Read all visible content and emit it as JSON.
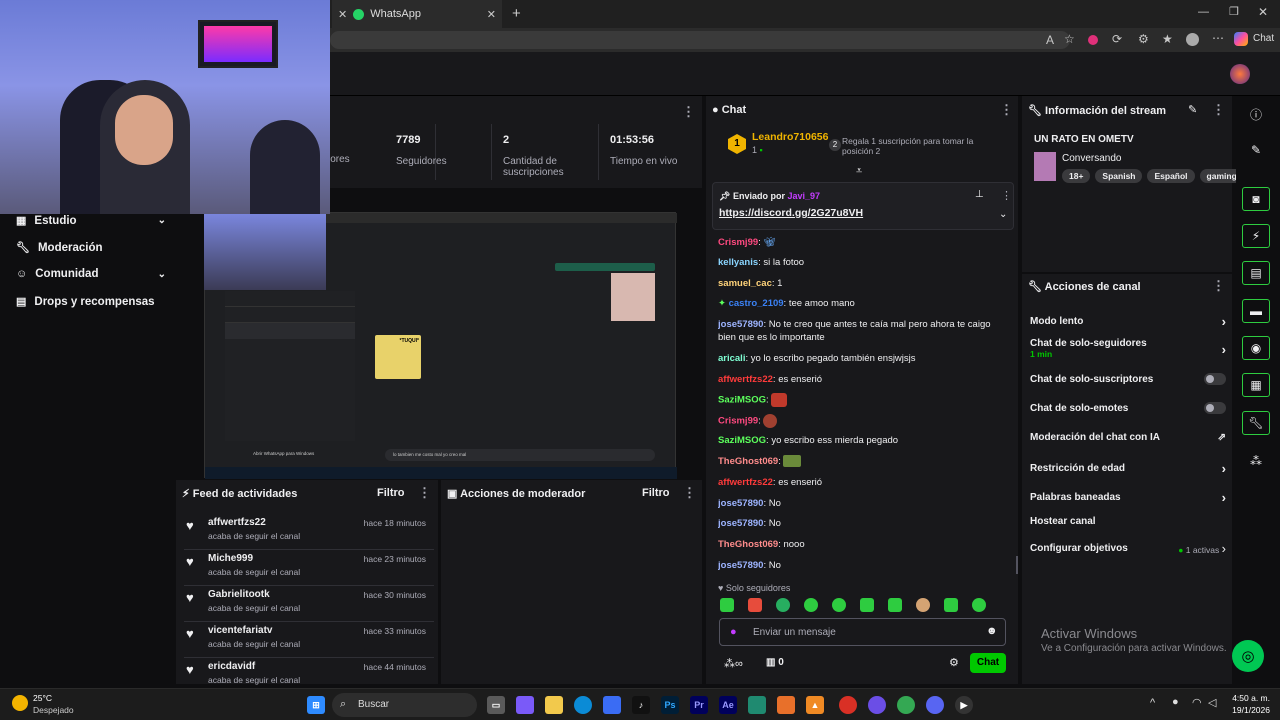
{
  "browser": {
    "tab_title": "WhatsApp",
    "chat_label": "Chat"
  },
  "stats": [
    {
      "value": "",
      "label": "lores"
    },
    {
      "value": "7789",
      "label": "Seguidores"
    },
    {
      "value": "2",
      "label": "Cantidad de suscripciones"
    },
    {
      "value": "01:53:56",
      "label": "Tiempo en vivo"
    }
  ],
  "sidebar": {
    "items": [
      {
        "label": "Estudio",
        "has_chevron": true
      },
      {
        "label": "Moderación",
        "has_chevron": false
      },
      {
        "label": "Comunidad",
        "has_chevron": true
      },
      {
        "label": "Drops y recompensas",
        "has_chevron": false
      }
    ]
  },
  "preview": {
    "banner_title": "Abrir WhatsApp para Windows",
    "tuqui_label": "*TUQUI*",
    "chat_input": "lo tambien me costo mal yo creo mal"
  },
  "activity_feed": {
    "title": "Feed de actividades",
    "filter": "Filtro",
    "items": [
      {
        "user": "affwertfzs22",
        "action": "acaba de seguir el canal",
        "time": "hace 18 minutos"
      },
      {
        "user": "Miche999",
        "action": "acaba de seguir el canal",
        "time": "hace 23 minutos"
      },
      {
        "user": "Gabrielitootk",
        "action": "acaba de seguir el canal",
        "time": "hace 30 minutos"
      },
      {
        "user": "vicentefariatv",
        "action": "acaba de seguir el canal",
        "time": "hace 33 minutos"
      },
      {
        "user": "ericdavidf",
        "action": "acaba de seguir el canal",
        "time": "hace 44 minutos"
      }
    ]
  },
  "mod_actions": {
    "title": "Acciones de moderador",
    "filter": "Filtro"
  },
  "chat": {
    "title": "Chat",
    "gift_user": "Leandro710656",
    "gift_count": "1",
    "gift_text": "Regala 1 suscripción para tomar la posición 2",
    "gift_rank": "2",
    "pinned_label": "Enviado por",
    "pinned_by": "Javi_97",
    "pinned_link": "https://discord.gg/2G27u8VH",
    "messages": [
      {
        "user": "Crismj99",
        "text": "",
        "color": "#ff4a80"
      },
      {
        "user": "kellyanis",
        "text": "si la fotoo",
        "color": "#8ad5ff"
      },
      {
        "user": "samuel_cac",
        "text": "1",
        "color": "#ffd37a"
      },
      {
        "user": "castro_2109",
        "text": "tee amoo mano",
        "color": "#3b82f6"
      },
      {
        "user": "jose57890",
        "text": "No te creo que antes te caía mal pero ahora te caigo bien que es lo importante",
        "color": "#9db4ff"
      },
      {
        "user": "aricali",
        "text": "yo lo escribo pegado también ensjwjsjs",
        "color": "#7fffd4"
      },
      {
        "user": "affwertfzs22",
        "text": "es enserió",
        "color": "#ff3b3b"
      },
      {
        "user": "SaziMSOG",
        "text": "",
        "color": "#5cff5c"
      },
      {
        "user": "Crismj99",
        "text": "",
        "color": "#ff4a80"
      },
      {
        "user": "SaziMSOG",
        "text": "yo escribo ess mierda pegado",
        "color": "#5cff5c"
      },
      {
        "user": "TheGhost069",
        "text": "",
        "color": "#ff8c8c"
      },
      {
        "user": "affwertfzs22",
        "text": "es enserió",
        "color": "#ff3b3b"
      },
      {
        "user": "jose57890",
        "text": "No",
        "color": "#9db4ff"
      },
      {
        "user": "jose57890",
        "text": "No",
        "color": "#9db4ff"
      },
      {
        "user": "TheGhost069",
        "text": "nooo",
        "color": "#ff8c8c"
      },
      {
        "user": "jose57890",
        "text": "No",
        "color": "#9db4ff"
      }
    ],
    "followers_only": "Solo seguidores",
    "input_placeholder": "Enviar un mensaje",
    "points": "0",
    "send_button": "Chat"
  },
  "stream_info": {
    "title": "Información del stream",
    "stream_title": "UN RATO EN OMETV",
    "category": "Conversando",
    "tags": [
      "18+",
      "Spanish",
      "Español",
      "gaming"
    ]
  },
  "channel_actions": {
    "title": "Acciones de canal",
    "items": [
      {
        "label": "Modo lento",
        "sub": "",
        "control": "chevron"
      },
      {
        "label": "Chat de solo-seguidores",
        "sub": "1 min",
        "control": "chevron"
      },
      {
        "label": "Chat de solo-suscriptores",
        "sub": "",
        "control": "toggle"
      },
      {
        "label": "Chat de solo-emotes",
        "sub": "",
        "control": "toggle"
      },
      {
        "label": "Moderación del chat con IA",
        "sub": "",
        "control": "external"
      },
      {
        "label": "Restricción de edad",
        "sub": "",
        "control": "chevron"
      },
      {
        "label": "Palabras baneadas",
        "sub": "",
        "control": "chevron"
      },
      {
        "label": "Hostear canal",
        "sub": "",
        "control": "none"
      },
      {
        "label": "Configurar objetivos",
        "sub": "",
        "control": "chevron",
        "status": "1 activas"
      }
    ]
  },
  "watermark": {
    "line1": "Activar Windows",
    "line2": "Ve a Configuración para activar Windows."
  },
  "taskbar": {
    "temp": "25°C",
    "weather": "Despejado",
    "search": "Buscar",
    "time": "4:50 a. m.",
    "date": "19/1/2026"
  },
  "colors": {
    "accent": "#9147ff",
    "bg": "#0e0e10",
    "panel": "#18181b",
    "send": "#00c800"
  }
}
